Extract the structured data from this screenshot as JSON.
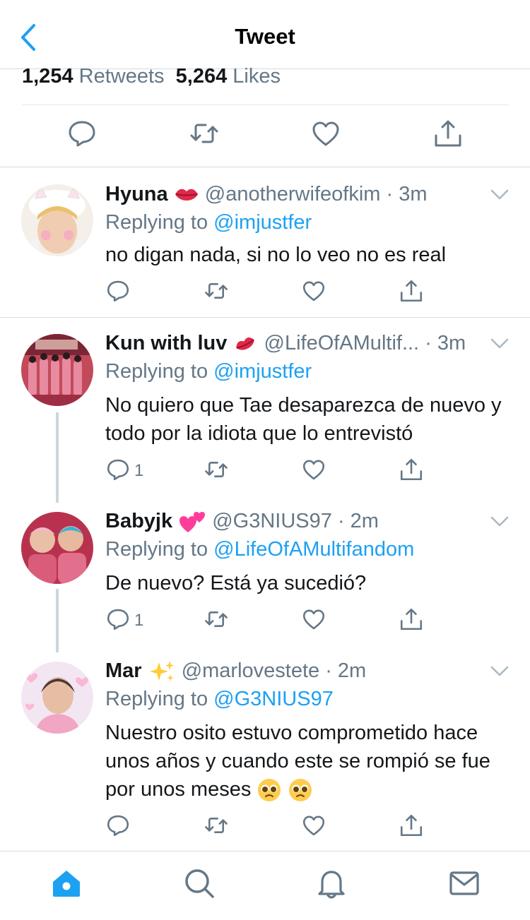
{
  "header": {
    "title": "Tweet"
  },
  "stats": {
    "retweets_count": "1,254",
    "retweets_label": "Retweets",
    "likes_count": "5,264",
    "likes_label": "Likes"
  },
  "replies": [
    {
      "name": "Hyuna",
      "handle": "@anotherwifeofkim",
      "time": "· 3m",
      "replying_prefix": "Replying to",
      "replying_to": "@imjustfer",
      "text": "no digan nada, si no lo veo no es real",
      "reply_count": ""
    },
    {
      "name": "Kun with luv",
      "handle": "@LifeOfAMultif...",
      "time": "· 3m",
      "replying_prefix": "Replying to",
      "replying_to": "@imjustfer",
      "text": "No quiero que Tae desaparezca de nuevo y todo por la idiota que lo entrevistó",
      "reply_count": "1"
    },
    {
      "name": "Babyjk",
      "handle": "@G3NIUS97",
      "time": "· 2m",
      "replying_prefix": "Replying to",
      "replying_to": "@LifeOfAMultifandom",
      "text": "De nuevo? Está ya sucedió?",
      "reply_count": "1"
    },
    {
      "name": "Mar",
      "handle": "@marlovestete",
      "time": "· 2m",
      "replying_prefix": "Replying to",
      "replying_to": "@G3NIUS97",
      "text": "Nuestro osito estuvo comprometido hace unos años y cuando este se rompió se fue por unos meses",
      "reply_count": ""
    }
  ],
  "colors": {
    "accent": "#1da1f2",
    "icon_gray": "#657786",
    "divider": "#d6dbdf"
  },
  "icons": [
    "back-chevron-icon",
    "reply-icon",
    "retweet-icon",
    "like-icon",
    "share-icon",
    "more-chevron-icon",
    "home-icon",
    "search-icon",
    "notifications-icon",
    "messages-icon"
  ]
}
